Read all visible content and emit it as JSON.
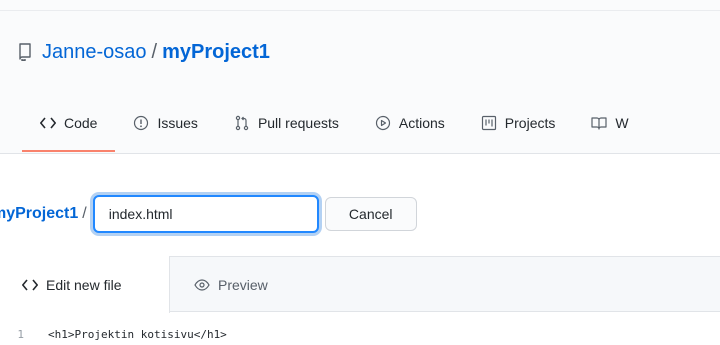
{
  "repo": {
    "owner": "Janne-osao",
    "separator": "/",
    "name": "myProject1"
  },
  "nav": {
    "tabs": [
      {
        "label": "Code",
        "icon": "code-icon",
        "selected": true
      },
      {
        "label": "Issues",
        "icon": "issue-icon"
      },
      {
        "label": "Pull requests",
        "icon": "pull-request-icon"
      },
      {
        "label": "Actions",
        "icon": "play-icon"
      },
      {
        "label": "Projects",
        "icon": "project-icon"
      },
      {
        "label": "W",
        "icon": "book-icon"
      }
    ]
  },
  "breadcrumb": {
    "repo": "myProject1",
    "separator": "/"
  },
  "filename": {
    "value": "index.html"
  },
  "cancel_label": "Cancel",
  "editor": {
    "tabs": [
      {
        "label": "Edit new file",
        "icon": "code-icon",
        "active": true
      },
      {
        "label": "Preview",
        "icon": "eye-icon"
      }
    ],
    "lines": [
      {
        "number": "1",
        "text": "<h1>Projektin kotisivu</h1>"
      }
    ]
  },
  "colors": {
    "link": "#0366d6",
    "selected_tab_underline": "#f9826c",
    "focus_border": "#2188ff"
  }
}
